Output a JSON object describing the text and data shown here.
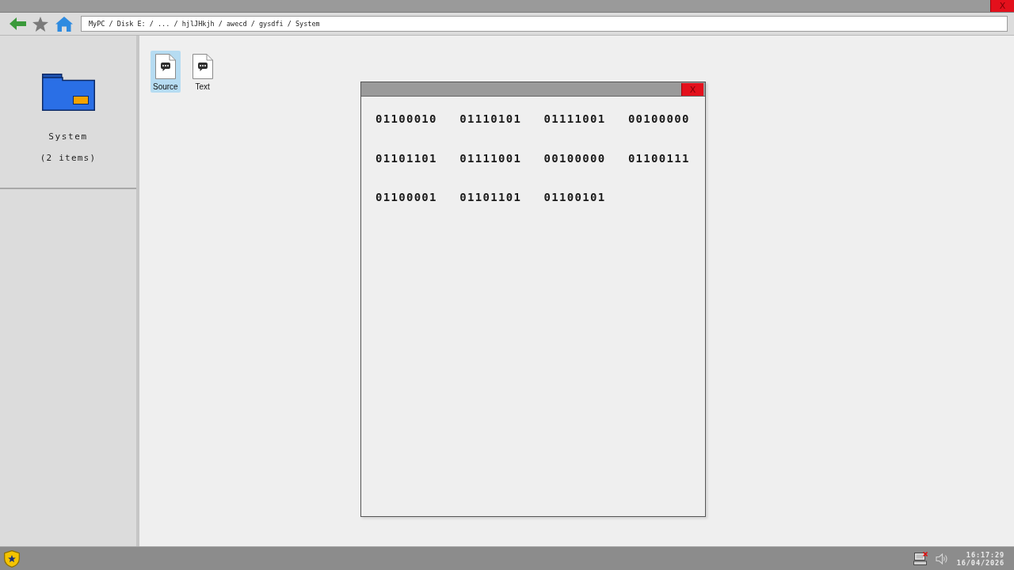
{
  "window": {
    "close_label": "X"
  },
  "toolbar": {
    "address": "MyPC / Disk E: / ... / hjlJHkjh / awecd / gysdfi / System"
  },
  "sidebar": {
    "folder_name": "System",
    "item_count": "(2 items)"
  },
  "files": [
    {
      "name": "Source",
      "selected": true
    },
    {
      "name": "Text",
      "selected": false
    }
  ],
  "popup": {
    "close_label": "X",
    "words": [
      "01100010",
      "01110101",
      "01111001",
      "00100000",
      "01101101",
      "01111001",
      "00100000",
      "01100111",
      "01100001",
      "01101101",
      "01100101"
    ]
  },
  "taskbar": {
    "time": "16:17:29",
    "date": "16/04/2026"
  }
}
